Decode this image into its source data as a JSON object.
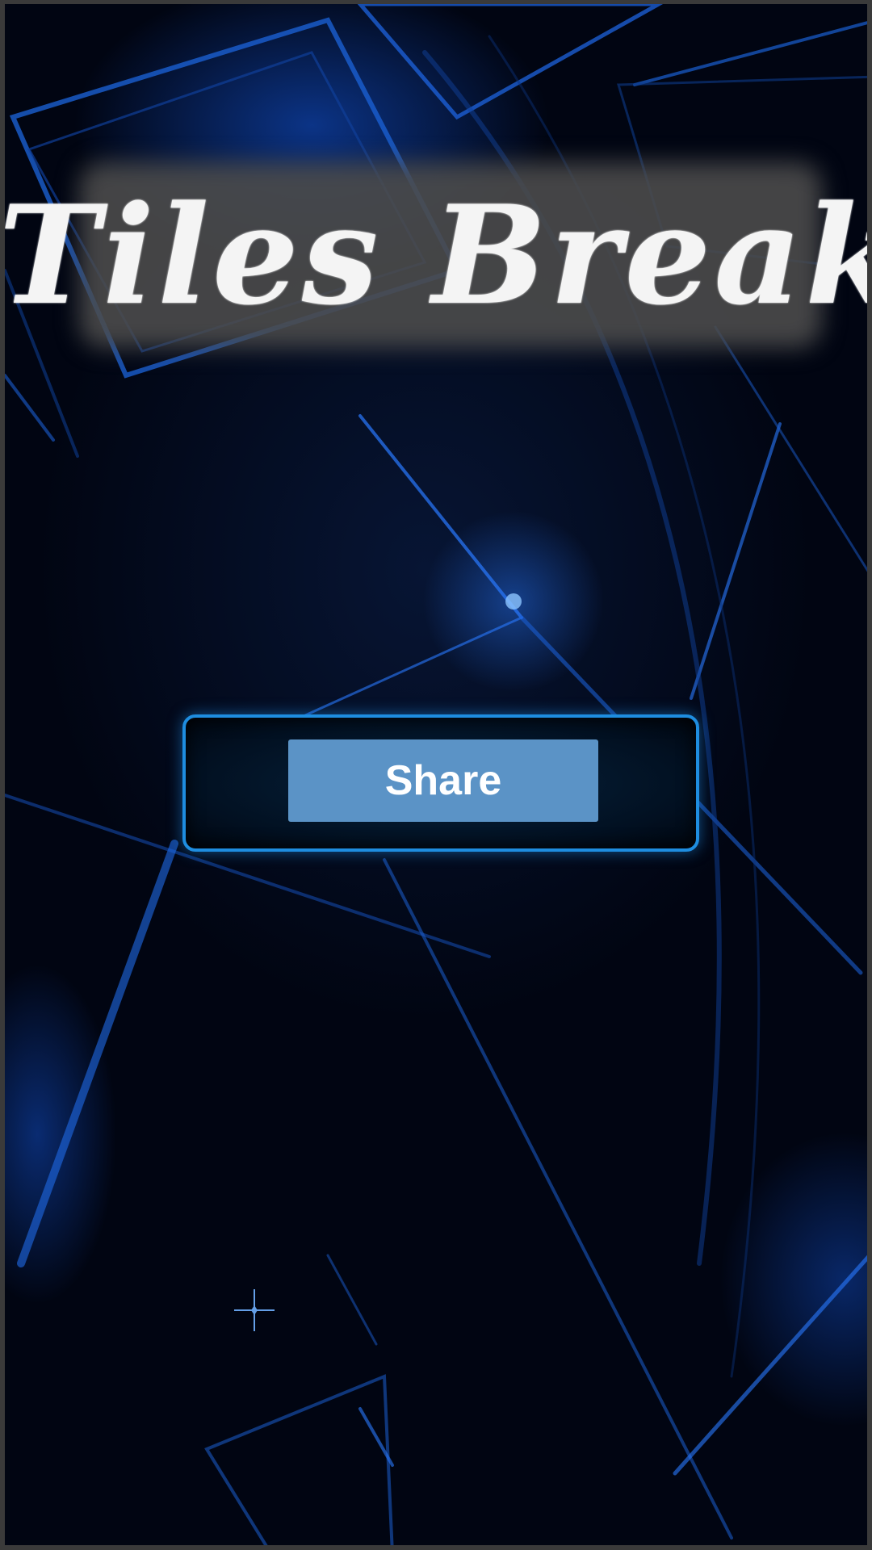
{
  "app": {
    "title": "Tiles Break"
  },
  "actions": {
    "share_label": "Share"
  },
  "colors": {
    "background": "#010512",
    "accent": "#1e8de0",
    "share_button": "#5b93c6",
    "title_text": "#f4f4f4"
  }
}
